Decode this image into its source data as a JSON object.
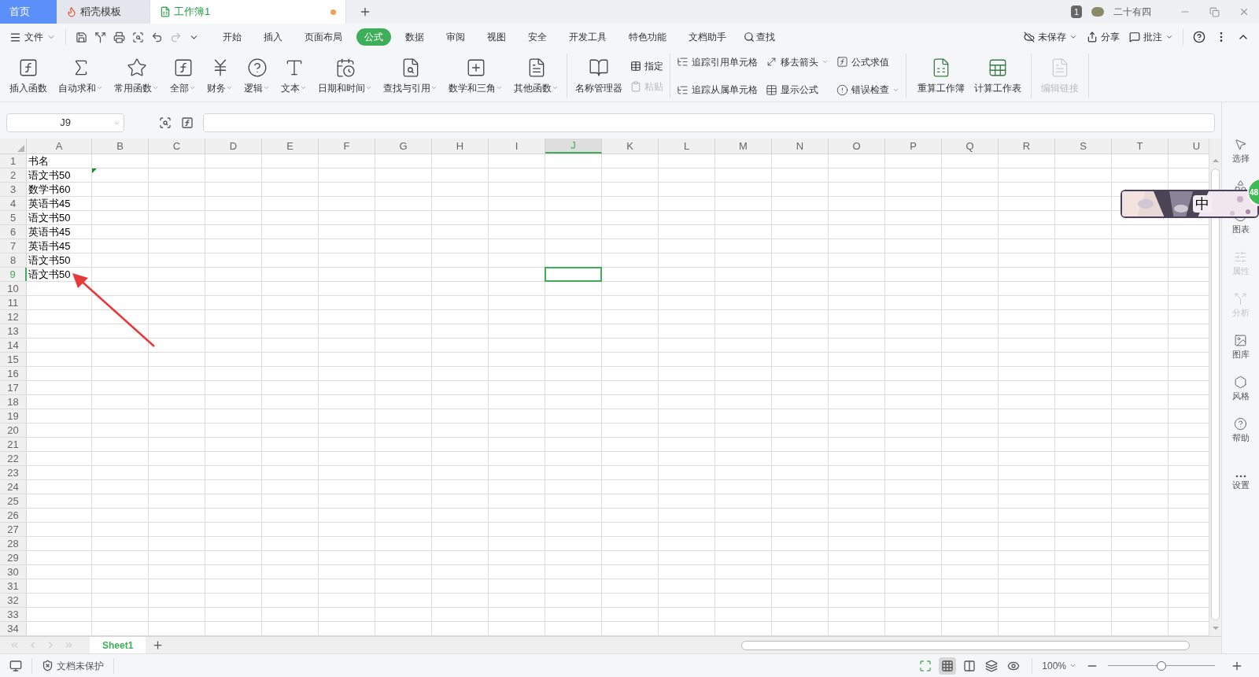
{
  "tabs": [
    {
      "label": "首页",
      "kind": "home",
      "selected": false
    },
    {
      "label": "稻壳模板",
      "kind": "docer",
      "selected": false
    },
    {
      "label": "工作簿1",
      "kind": "sheet",
      "selected": true,
      "unsaved": true
    }
  ],
  "title_bar": {
    "page_count": "1",
    "user": "二十有四"
  },
  "menu": {
    "file": "文件",
    "search": "查找",
    "tabs": [
      {
        "label": "开始",
        "selected": false
      },
      {
        "label": "插入",
        "selected": false
      },
      {
        "label": "页面布局",
        "selected": false
      },
      {
        "label": "公式",
        "selected": true
      },
      {
        "label": "数据",
        "selected": false
      },
      {
        "label": "审阅",
        "selected": false
      },
      {
        "label": "视图",
        "selected": false
      },
      {
        "label": "安全",
        "selected": false
      },
      {
        "label": "开发工具",
        "selected": false
      },
      {
        "label": "特色功能",
        "selected": false
      },
      {
        "label": "文档助手",
        "selected": false
      }
    ],
    "actions": [
      {
        "label": "未保存",
        "dropdown": true
      },
      {
        "label": "分享",
        "dropdown": false
      },
      {
        "label": "批注",
        "dropdown": true
      }
    ]
  },
  "ribbon": {
    "functions": [
      {
        "label": "插入函数",
        "dropdown": false
      },
      {
        "label": "自动求和",
        "dropdown": true
      },
      {
        "label": "常用函数",
        "dropdown": true
      },
      {
        "label": "全部",
        "dropdown": true
      },
      {
        "label": "财务",
        "dropdown": true
      },
      {
        "label": "逻辑",
        "dropdown": true
      },
      {
        "label": "文本",
        "dropdown": true
      },
      {
        "label": "日期和时间",
        "dropdown": true
      },
      {
        "label": "查找与引用",
        "dropdown": true
      },
      {
        "label": "数学和三角",
        "dropdown": true
      },
      {
        "label": "其他函数",
        "dropdown": true
      }
    ],
    "names": {
      "label": "名称管理器",
      "small": [
        {
          "label": "指定",
          "disabled": false
        },
        {
          "label": "粘贴",
          "disabled": true
        }
      ]
    },
    "audit": [
      {
        "label": "追踪引用单元格",
        "dropdown": false
      },
      {
        "label": "追踪从属单元格",
        "dropdown": false
      },
      {
        "label": "移去箭头",
        "dropdown": true
      },
      {
        "label": "显示公式",
        "dropdown": false
      },
      {
        "label": "公式求值",
        "dropdown": false
      },
      {
        "label": "错误检查",
        "dropdown": true
      }
    ],
    "calc": [
      {
        "label": "重算工作簿",
        "disabled": false
      },
      {
        "label": "计算工作表",
        "disabled": false
      },
      {
        "label": "编辑链接",
        "disabled": true
      }
    ]
  },
  "name_box": "J9",
  "columns": [
    {
      "label": "A",
      "selected": false
    },
    {
      "label": "B",
      "selected": false
    },
    {
      "label": "C",
      "selected": false
    },
    {
      "label": "D",
      "selected": false
    },
    {
      "label": "E",
      "selected": false
    },
    {
      "label": "F",
      "selected": false
    },
    {
      "label": "G",
      "selected": false
    },
    {
      "label": "H",
      "selected": false
    },
    {
      "label": "I",
      "selected": false
    },
    {
      "label": "J",
      "selected": true
    },
    {
      "label": "K",
      "selected": false
    },
    {
      "label": "L",
      "selected": false
    },
    {
      "label": "M",
      "selected": false
    },
    {
      "label": "N",
      "selected": false
    },
    {
      "label": "O",
      "selected": false
    },
    {
      "label": "P",
      "selected": false
    },
    {
      "label": "Q",
      "selected": false
    },
    {
      "label": "R",
      "selected": false
    },
    {
      "label": "S",
      "selected": false
    },
    {
      "label": "T",
      "selected": false
    },
    {
      "label": "U",
      "selected": false
    }
  ],
  "rows": [
    {
      "number": "1",
      "selected": false,
      "value": "书名"
    },
    {
      "number": "2",
      "selected": false,
      "value": "语文书50",
      "flag": true
    },
    {
      "number": "3",
      "selected": false,
      "value": "数学书60"
    },
    {
      "number": "4",
      "selected": false,
      "value": "英语书45"
    },
    {
      "number": "5",
      "selected": false,
      "value": "语文书50"
    },
    {
      "number": "6",
      "selected": false,
      "value": "英语书45"
    },
    {
      "number": "7",
      "selected": false,
      "value": "英语书45"
    },
    {
      "number": "8",
      "selected": false,
      "value": "语文书50"
    },
    {
      "number": "9",
      "selected": true,
      "value": "语文书50"
    },
    {
      "number": "10",
      "selected": false
    },
    {
      "number": "11",
      "selected": false
    },
    {
      "number": "12",
      "selected": false
    },
    {
      "number": "13",
      "selected": false
    },
    {
      "number": "14",
      "selected": false
    },
    {
      "number": "15",
      "selected": false
    },
    {
      "number": "16",
      "selected": false
    },
    {
      "number": "17",
      "selected": false
    },
    {
      "number": "18",
      "selected": false
    },
    {
      "number": "19",
      "selected": false
    },
    {
      "number": "20",
      "selected": false
    },
    {
      "number": "21",
      "selected": false
    },
    {
      "number": "22",
      "selected": false
    },
    {
      "number": "23",
      "selected": false
    },
    {
      "number": "24",
      "selected": false
    },
    {
      "number": "25",
      "selected": false
    },
    {
      "number": "26",
      "selected": false
    },
    {
      "number": "27",
      "selected": false
    },
    {
      "number": "28",
      "selected": false
    },
    {
      "number": "29",
      "selected": false
    },
    {
      "number": "30",
      "selected": false
    },
    {
      "number": "31",
      "selected": false
    },
    {
      "number": "32",
      "selected": false
    },
    {
      "number": "33",
      "selected": false
    },
    {
      "number": "34",
      "selected": false
    }
  ],
  "sidebar": [
    {
      "label": "选择",
      "disabled": false
    },
    {
      "disabled": false
    },
    {
      "label": "图表",
      "disabled": false
    },
    {
      "label": "属性",
      "disabled": true
    },
    {
      "label": "分析",
      "disabled": true
    },
    {
      "label": "图库",
      "disabled": false
    },
    {
      "label": "风格",
      "disabled": false
    },
    {
      "label": "帮助",
      "disabled": false
    },
    {
      "label": "设置",
      "disabled": false
    }
  ],
  "ime_widget": {
    "mode": "中",
    "badge": "48"
  },
  "sheet_tabs": [
    {
      "label": "Sheet1",
      "selected": true
    }
  ],
  "status_bar": {
    "protection": "文档未保护",
    "views": [
      {
        "selected": false
      },
      {
        "selected": true
      },
      {
        "selected": false
      },
      {
        "selected": false
      },
      {
        "selected": false
      }
    ],
    "zoom": "100%",
    "zoom_slider": {
      "level": 0.5
    }
  }
}
